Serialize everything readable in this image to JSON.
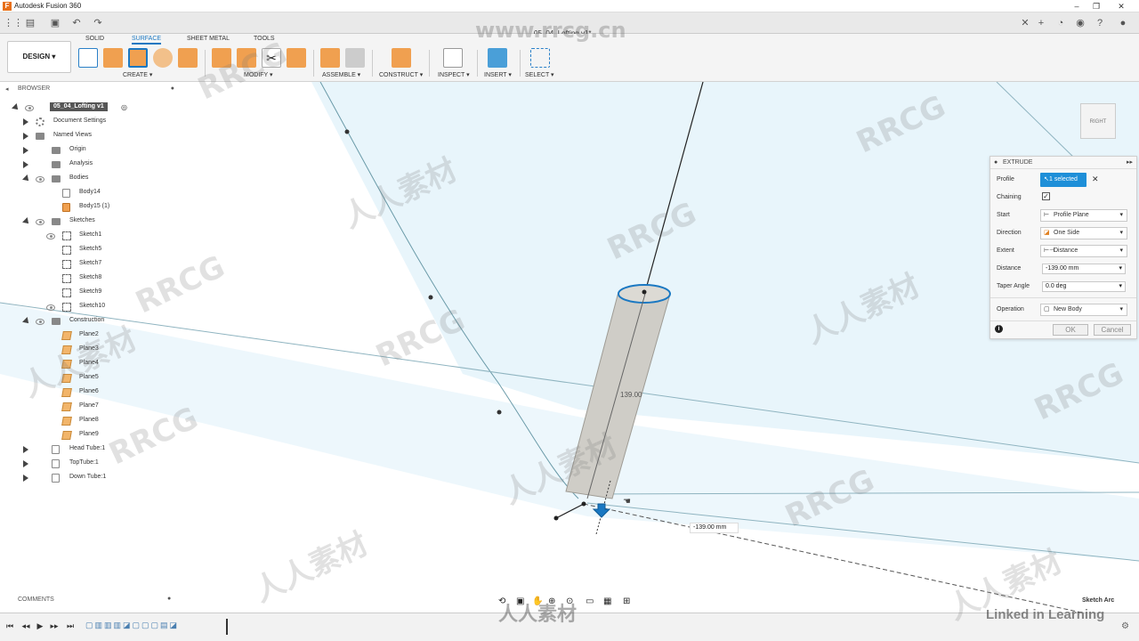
{
  "window": {
    "app_title": "Autodesk Fusion 360",
    "doc_tab": "05_04_Lofting v1*"
  },
  "toolbar": {
    "workspace": "DESIGN",
    "tabs": [
      "SOLID",
      "SURFACE",
      "SHEET METAL",
      "TOOLS"
    ],
    "active_tab": "SURFACE",
    "groups": [
      "CREATE ▾",
      "MODIFY ▾",
      "ASSEMBLE ▾",
      "CONSTRUCT ▾",
      "INSPECT ▾",
      "INSERT ▾",
      "SELECT ▾"
    ]
  },
  "browser": {
    "title": "BROWSER",
    "document": "05_04_Lofting v1",
    "items": [
      {
        "label": "Document Settings"
      },
      {
        "label": "Named Views"
      },
      {
        "label": "Origin"
      },
      {
        "label": "Analysis"
      },
      {
        "label": "Bodies"
      },
      {
        "label": "Body14"
      },
      {
        "label": "Body15 (1)"
      },
      {
        "label": "Sketches"
      },
      {
        "label": "Sketch1"
      },
      {
        "label": "Sketch5"
      },
      {
        "label": "Sketch7"
      },
      {
        "label": "Sketch8"
      },
      {
        "label": "Sketch9"
      },
      {
        "label": "Sketch10"
      },
      {
        "label": "Construction"
      },
      {
        "label": "Plane2"
      },
      {
        "label": "Plane3"
      },
      {
        "label": "Plane4"
      },
      {
        "label": "Plane5"
      },
      {
        "label": "Plane6"
      },
      {
        "label": "Plane7"
      },
      {
        "label": "Plane8"
      },
      {
        "label": "Plane9"
      },
      {
        "label": "Head Tube:1"
      },
      {
        "label": "TopTube:1"
      },
      {
        "label": "Down Tube:1"
      }
    ]
  },
  "extrude": {
    "title": "EXTRUDE",
    "profile_label": "Profile",
    "profile_value": "1 selected",
    "chaining_label": "Chaining",
    "start_label": "Start",
    "start_value": "Profile Plane",
    "direction_label": "Direction",
    "direction_value": "One Side",
    "extent_label": "Extent",
    "extent_value": "Distance",
    "distance_label": "Distance",
    "distance_value": "-139.00 mm",
    "taper_label": "Taper Angle",
    "taper_value": "0.0 deg",
    "operation_label": "Operation",
    "operation_value": "New Body",
    "ok": "OK",
    "cancel": "Cancel"
  },
  "viewport": {
    "dimension_label": "139.00",
    "distance_input": "-139.00 mm",
    "viewcube_face": "RIGHT",
    "status_text": "Sketch Arc"
  },
  "comments": {
    "title": "COMMENTS"
  },
  "watermarks": {
    "site": "www.rrcg.cn",
    "brand": "RRCG",
    "cn": "人人素材",
    "linkedin": "Linked in Learning"
  }
}
